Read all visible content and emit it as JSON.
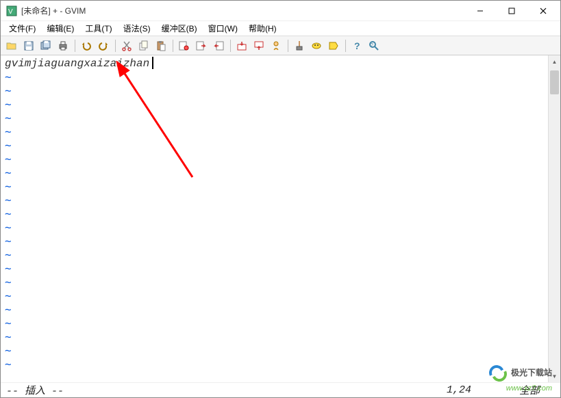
{
  "titlebar": {
    "title": "[未命名] + - GVIM"
  },
  "menubar": {
    "file": "文件(F)",
    "edit": "编辑(E)",
    "tools": "工具(T)",
    "syntax": "语法(S)",
    "buffers": "缓冲区(B)",
    "window": "窗口(W)",
    "help": "帮助(H)"
  },
  "editor": {
    "content": "gvimjiaguangxaizaizhan",
    "tilde": "~"
  },
  "status": {
    "mode": "-- 插入 --",
    "position": "1,24",
    "view": "全部"
  },
  "watermark": {
    "line1": "极光下载站",
    "line2": "www.xz7.com"
  },
  "icons": {
    "open": "open-icon",
    "save": "save-icon",
    "saveall": "saveall-icon",
    "print": "print-icon",
    "undo": "undo-icon",
    "redo": "redo-icon",
    "cut": "cut-icon",
    "copy": "copy-icon",
    "paste": "paste-icon",
    "replace": "replace-icon",
    "findnext": "findnext-icon",
    "findprev": "findprev-icon",
    "session_new": "session-new-icon",
    "session_load": "session-load-icon",
    "script": "script-icon",
    "make": "make-icon",
    "shell": "shell-icon",
    "tags": "tags-icon",
    "help": "help-icon",
    "findhelp": "findhelp-icon"
  }
}
